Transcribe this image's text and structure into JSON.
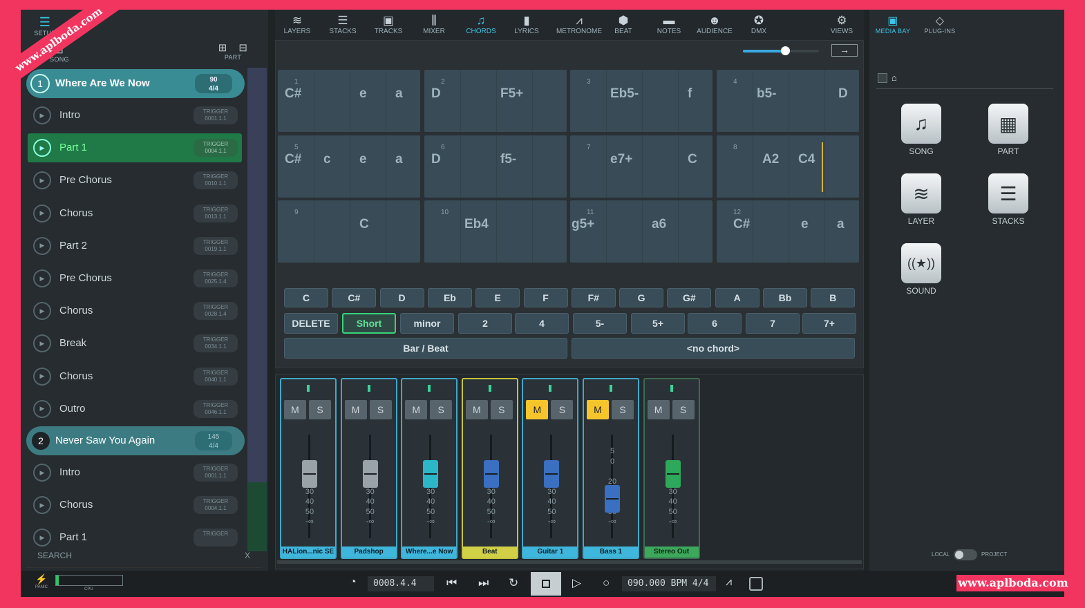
{
  "left_toolbar": {
    "setup_label": "SETUP",
    "song_label": "SONG",
    "part_label": "PART"
  },
  "songs": [
    {
      "num": "1",
      "name": "Where Are We Now",
      "bpm": "90",
      "sig": "4/4"
    },
    {
      "num": "2",
      "name": "Never Saw You Again",
      "bpm": "145",
      "sig": "4/4"
    }
  ],
  "parts_song1": [
    {
      "name": "Intro",
      "trigger": "TRIGGER",
      "pos": "0001.1.1"
    },
    {
      "name": "Part 1",
      "trigger": "TRIGGER",
      "pos": "0004.1.1"
    },
    {
      "name": "Pre Chorus",
      "trigger": "TRIGGER",
      "pos": "0010.1.1"
    },
    {
      "name": "Chorus",
      "trigger": "TRIGGER",
      "pos": "0013.1.1"
    },
    {
      "name": "Part 2",
      "trigger": "TRIGGER",
      "pos": "0019.1.1"
    },
    {
      "name": "Pre Chorus",
      "trigger": "TRIGGER",
      "pos": "0025.1.4"
    },
    {
      "name": "Chorus",
      "trigger": "TRIGGER",
      "pos": "0028.1.4"
    },
    {
      "name": "Break",
      "trigger": "TRIGGER",
      "pos": "0034.1.1"
    },
    {
      "name": "Chorus",
      "trigger": "TRIGGER",
      "pos": "0040.1.1"
    },
    {
      "name": "Outro",
      "trigger": "TRIGGER",
      "pos": "0046.1.1"
    }
  ],
  "parts_song2": [
    {
      "name": "Intro",
      "trigger": "TRIGGER",
      "pos": "0001.1.1"
    },
    {
      "name": "Chorus",
      "trigger": "TRIGGER",
      "pos": "0004.1.1"
    },
    {
      "name": "Part 1",
      "trigger": "TRIGGER",
      "pos": ""
    }
  ],
  "search": {
    "label": "SEARCH",
    "clear": "X"
  },
  "nav": [
    "LAYERS",
    "STACKS",
    "TRACKS",
    "MIXER",
    "CHORDS",
    "LYRICS",
    "METRONOME",
    "BEAT",
    "NOTES",
    "AUDIENCE",
    "DMX",
    "VIEWS"
  ],
  "right_nav": [
    "MEDIA BAY",
    "PLUG-INS"
  ],
  "zoom": 0.55,
  "chord_cells": [
    {
      "idx": "1",
      "chords": [
        "C#",
        "e",
        "a"
      ]
    },
    {
      "idx": "2",
      "chords": [
        "D",
        "F5+"
      ]
    },
    {
      "idx": "3",
      "chords": [
        "Eb5-",
        "f"
      ]
    },
    {
      "idx": "4",
      "chords": [
        "b5-",
        "D"
      ]
    },
    {
      "idx": "5",
      "chords": [
        "C#",
        "c",
        "e",
        "a"
      ]
    },
    {
      "idx": "6",
      "chords": [
        "D",
        "f5-"
      ]
    },
    {
      "idx": "7",
      "chords": [
        "e7+",
        "C"
      ]
    },
    {
      "idx": "8",
      "chords": [
        "A2",
        "C4"
      ]
    },
    {
      "idx": "9",
      "chords": [
        "C"
      ]
    },
    {
      "idx": "10",
      "chords": [
        "Eb4"
      ]
    },
    {
      "idx": "11",
      "chords": [
        "g5+",
        "a6"
      ]
    },
    {
      "idx": "12",
      "chords": [
        "C#",
        "e",
        "a"
      ]
    }
  ],
  "roots": [
    "C",
    "C#",
    "D",
    "Eb",
    "E",
    "F",
    "F#",
    "G",
    "G#",
    "A",
    "Bb",
    "B"
  ],
  "qualities": [
    "DELETE",
    "Short",
    "minor",
    "2",
    "4",
    "5-",
    "5+",
    "6",
    "7",
    "7+"
  ],
  "bottom_keys": [
    "Bar / Beat",
    "<no chord>"
  ],
  "strips": [
    {
      "name": "HALion...nic SE",
      "m": false,
      "level": 0.38,
      "color": "#9aa3a8"
    },
    {
      "name": "Padshop",
      "m": false,
      "level": 0.38,
      "color": "#9aa3a8"
    },
    {
      "name": "Where...e Now",
      "m": false,
      "level": 0.38,
      "color": "#2bb7c9"
    },
    {
      "name": "Beat",
      "m": false,
      "level": 0.38,
      "color": "#3a6fc1"
    },
    {
      "name": "Guitar 1",
      "m": true,
      "level": 0.38,
      "color": "#3a6fc1"
    },
    {
      "name": "Bass 1",
      "m": true,
      "level": 0.62,
      "color": "#3a6fc1"
    },
    {
      "name": "Stereo Out",
      "m": false,
      "level": 0.38,
      "color": "#2ea85a"
    }
  ],
  "mute_label": "M",
  "solo_label": "S",
  "scale_labels": [
    "20",
    "30",
    "40",
    "50",
    "-∞"
  ],
  "bass_scale": [
    "5",
    "0"
  ],
  "media": [
    {
      "label": "SONG",
      "icon": "♫"
    },
    {
      "label": "PART",
      "icon": "▦"
    },
    {
      "label": "LAYER",
      "icon": "≋"
    },
    {
      "label": "STACKS",
      "icon": "☰"
    },
    {
      "label": "SOUND",
      "icon": "((★))"
    }
  ],
  "right_footer": {
    "local": "LOCAL",
    "project": "PROJECT"
  },
  "transport": {
    "panic": "PANIC",
    "cpu": "CPU",
    "position": "0008.4.4",
    "tempo": "090.000 BPM",
    "signature": "4/4"
  },
  "watermark": "www.aplboda.com"
}
